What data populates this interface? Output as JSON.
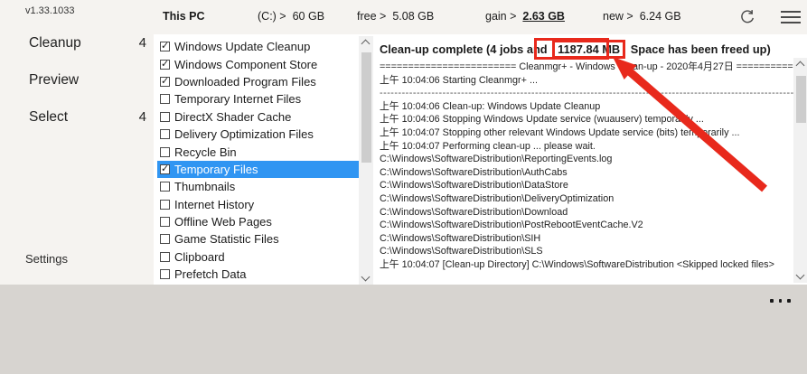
{
  "app": {
    "version": "v1.33.1033"
  },
  "topbar": {
    "device": "This PC",
    "stats": [
      {
        "label": "(C:) >",
        "value": "60 GB",
        "cls": "s0"
      },
      {
        "label": "free >",
        "value": "5.08 GB",
        "cls": "s1"
      },
      {
        "label": "gain >",
        "value": "2.63 GB",
        "cls": "s2",
        "em": true
      },
      {
        "label": "new >",
        "value": "6.24 GB",
        "cls": "s3"
      }
    ]
  },
  "sidebar": {
    "items": [
      {
        "label": "Cleanup",
        "count": "4",
        "cls": "nav0"
      },
      {
        "label": "Preview",
        "count": "",
        "cls": "nav1"
      },
      {
        "label": "Select",
        "count": "4",
        "cls": "nav2"
      },
      {
        "label": "Settings",
        "count": "",
        "cls": "nav3"
      }
    ]
  },
  "cleanup_list": {
    "items": [
      {
        "label": "Windows Update Cleanup",
        "checked": true
      },
      {
        "label": "Windows Component Store",
        "checked": true
      },
      {
        "label": "Downloaded Program Files",
        "checked": true
      },
      {
        "label": "Temporary Internet Files"
      },
      {
        "label": "DirectX Shader Cache"
      },
      {
        "label": "Delivery Optimization Files"
      },
      {
        "label": "Recycle Bin"
      },
      {
        "label": "Temporary Files",
        "checked": true,
        "selected": true
      },
      {
        "label": "Thumbnails"
      },
      {
        "label": "Internet History"
      },
      {
        "label": "Offline Web Pages"
      },
      {
        "label": "Game Statistic Files"
      },
      {
        "label": "Clipboard"
      },
      {
        "label": "Prefetch Data"
      }
    ]
  },
  "log": {
    "header_pre": "Clean-up complete (4 jobs and",
    "header_boxed": "1187.84 MB",
    "header_post": "Space has been freed up)",
    "lines": [
      {
        "text": "======================== Cleanmgr+ - Windows Clean-up - 2020年4月27日 ========================"
      },
      {
        "text": "上午 10:04:06 Starting Cleanmgr+ ..."
      },
      {
        "text": "--------------------------------------------------------------------------------------------------------------------------------------------------------",
        "sep": true
      },
      {
        "text": "上午 10:04:06 Clean-up: Windows Update Cleanup"
      },
      {
        "text": "上午 10:04:06 Stopping Windows Update service (wuauserv) temporarily ..."
      },
      {
        "text": "上午 10:04:07 Stopping other relevant Windows Update service (bits) temporarily ..."
      },
      {
        "text": "上午 10:04:07 Performing clean-up ... please wait."
      },
      {
        "text": "C:\\Windows\\SoftwareDistribution\\ReportingEvents.log"
      },
      {
        "text": "C:\\Windows\\SoftwareDistribution\\AuthCabs"
      },
      {
        "text": "C:\\Windows\\SoftwareDistribution\\DataStore"
      },
      {
        "text": "C:\\Windows\\SoftwareDistribution\\DeliveryOptimization"
      },
      {
        "text": "C:\\Windows\\SoftwareDistribution\\Download"
      },
      {
        "text": "C:\\Windows\\SoftwareDistribution\\PostRebootEventCache.V2"
      },
      {
        "text": "C:\\Windows\\SoftwareDistribution\\SIH"
      },
      {
        "text": "C:\\Windows\\SoftwareDistribution\\SLS"
      },
      {
        "text": "上午 10:04:07 [Clean-up Directory] C:\\Windows\\SoftwareDistribution <Skipped locked files>"
      }
    ]
  },
  "colors": {
    "accent_blue": "#3095f2",
    "annotation_red": "#e8291c"
  }
}
